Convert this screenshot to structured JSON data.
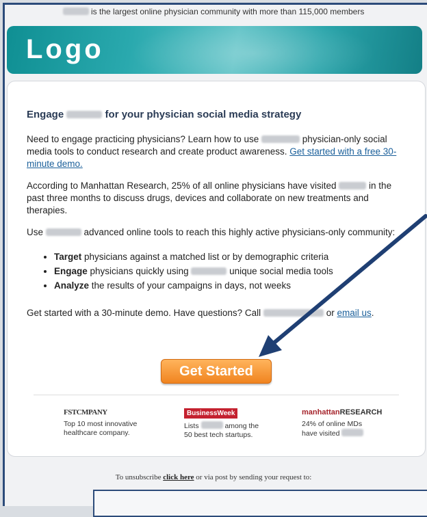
{
  "header": {
    "tagline": "is the largest online physician community with more than 115,000 members"
  },
  "banner": {
    "logo_text": "Logo"
  },
  "main": {
    "heading_prefix": "Engage",
    "heading_suffix": "for your physician social media strategy",
    "p1_part1": "Need to engage practicing physicians? Learn how to use",
    "p1_part2": "physician-only social media tools to conduct research and create product awareness.",
    "p1_link": "Get started with a free 30-minute demo.",
    "p2_part1": "According to Manhattan Research, 25% of all online physicians have visited",
    "p2_part2": "in the past three months to discuss drugs, devices and collaborate on new treatments and therapies.",
    "p3_part1": "Use",
    "p3_part2": "advanced online tools to reach this highly active physicians-only community:",
    "bullets": [
      {
        "bold": "Target",
        "text": "physicians against a matched list or by demographic criteria"
      },
      {
        "bold": "Engage",
        "text": "physicians quickly using",
        "text2": "unique social media tools"
      },
      {
        "bold": "Analyze",
        "text": "the results of your campaigns in days, not weeks"
      }
    ],
    "p4_part1": "Get started with a 30-minute demo. Have questions? Call",
    "p4_part2": "or",
    "p4_link": "email us",
    "p4_end": "."
  },
  "cta": {
    "label": "Get Started"
  },
  "press": {
    "fastcompany": {
      "brand": "FSTCMPANY",
      "line1": "Top 10 most innovative",
      "line2": "healthcare company."
    },
    "businessweek": {
      "brand": "BusinessWeek",
      "line1a": "Lists",
      "line1b": "among the",
      "line2": "50 best tech startups."
    },
    "manhattan": {
      "brand_light": "manhattan",
      "brand_dark": "RESEARCH",
      "line1": "24% of online MDs",
      "line2": "have visited"
    }
  },
  "footer": {
    "text1": "To unsubscribe",
    "link": "click here",
    "text2": "or via post by sending your request to:"
  },
  "colors": {
    "accent": "#1a5f9a",
    "cta": "#f08420",
    "banner": "#2aa9ae",
    "arrow": "#1f3f73"
  }
}
